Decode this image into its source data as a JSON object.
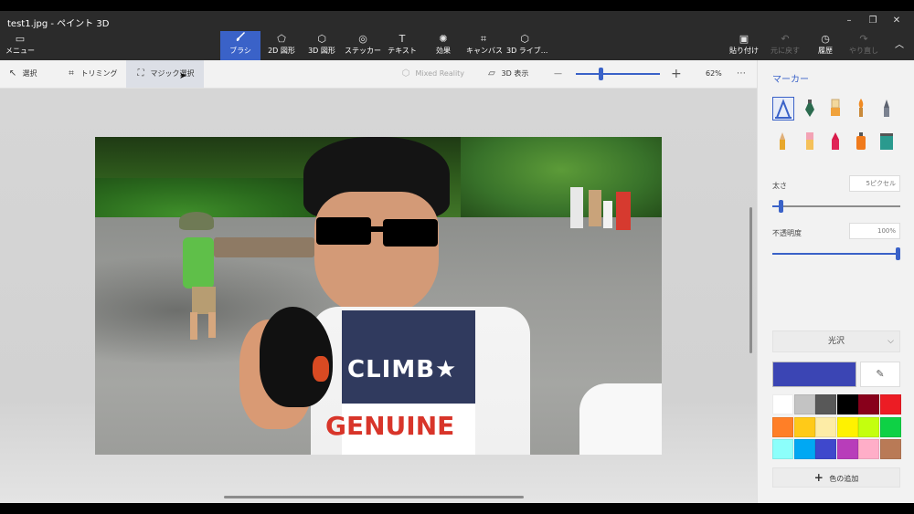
{
  "window": {
    "title": "test1.jpg - ペイント 3D"
  },
  "window_controls": {
    "minimize": "–",
    "maximize": "❐",
    "close": "✕"
  },
  "ribbon": {
    "menu": "メニュー",
    "brushes": "ブラシ",
    "shapes_2d": "2D 図形",
    "shapes_3d": "3D 図形",
    "stickers": "ステッカー",
    "text": "テキスト",
    "effects": "効果",
    "canvas": "キャンバス",
    "library_3d": "3D ライブ...",
    "paste": "貼り付け",
    "undo": "元に戻す",
    "history": "履歴",
    "redo": "やり直し",
    "collapse": "︿"
  },
  "toolbar": {
    "select": "選択",
    "crop": "トリミング",
    "magic_select": "マジック選択",
    "mixed_reality": "Mixed Reality",
    "view_3d": "3D 表示",
    "zoom_out": "—",
    "zoom_in": "+",
    "zoom_level": "62%",
    "more": "⋯",
    "zoom_value_percent": 62
  },
  "panel": {
    "title": "マーカー",
    "thickness_label": "太さ",
    "thickness_value": "5ピクセル",
    "opacity_label": "不透明度",
    "opacity_value": "100%",
    "finish": "光沢",
    "finish_chevron": "⌵",
    "eyedropper": "✎",
    "add_color": "色の追加",
    "add_color_icon": "+",
    "thickness_fraction": 0.05,
    "opacity_fraction": 1.0,
    "selected_color": "#3b45b4",
    "brushes": [
      "marker-icon",
      "calligraphy-pen-icon",
      "oil-brush-icon",
      "watercolor-icon",
      "pixel-pen-icon",
      "pencil-icon",
      "eraser-icon",
      "crayon-icon",
      "spray-can-icon",
      "fill-bucket-icon"
    ],
    "palette": [
      "#ffffff",
      "#c3c3c3",
      "#585858",
      "#000000",
      "#88001b",
      "#ec1c24",
      "#ff7f27",
      "#ffca18",
      "#fdeca6",
      "#fff200",
      "#c4ff0e",
      "#0ed145",
      "#8cfffb",
      "#00a8f3",
      "#3f48cc",
      "#b83dba",
      "#ffaec8",
      "#b97a56"
    ]
  },
  "accent_color": "#3a62c8"
}
